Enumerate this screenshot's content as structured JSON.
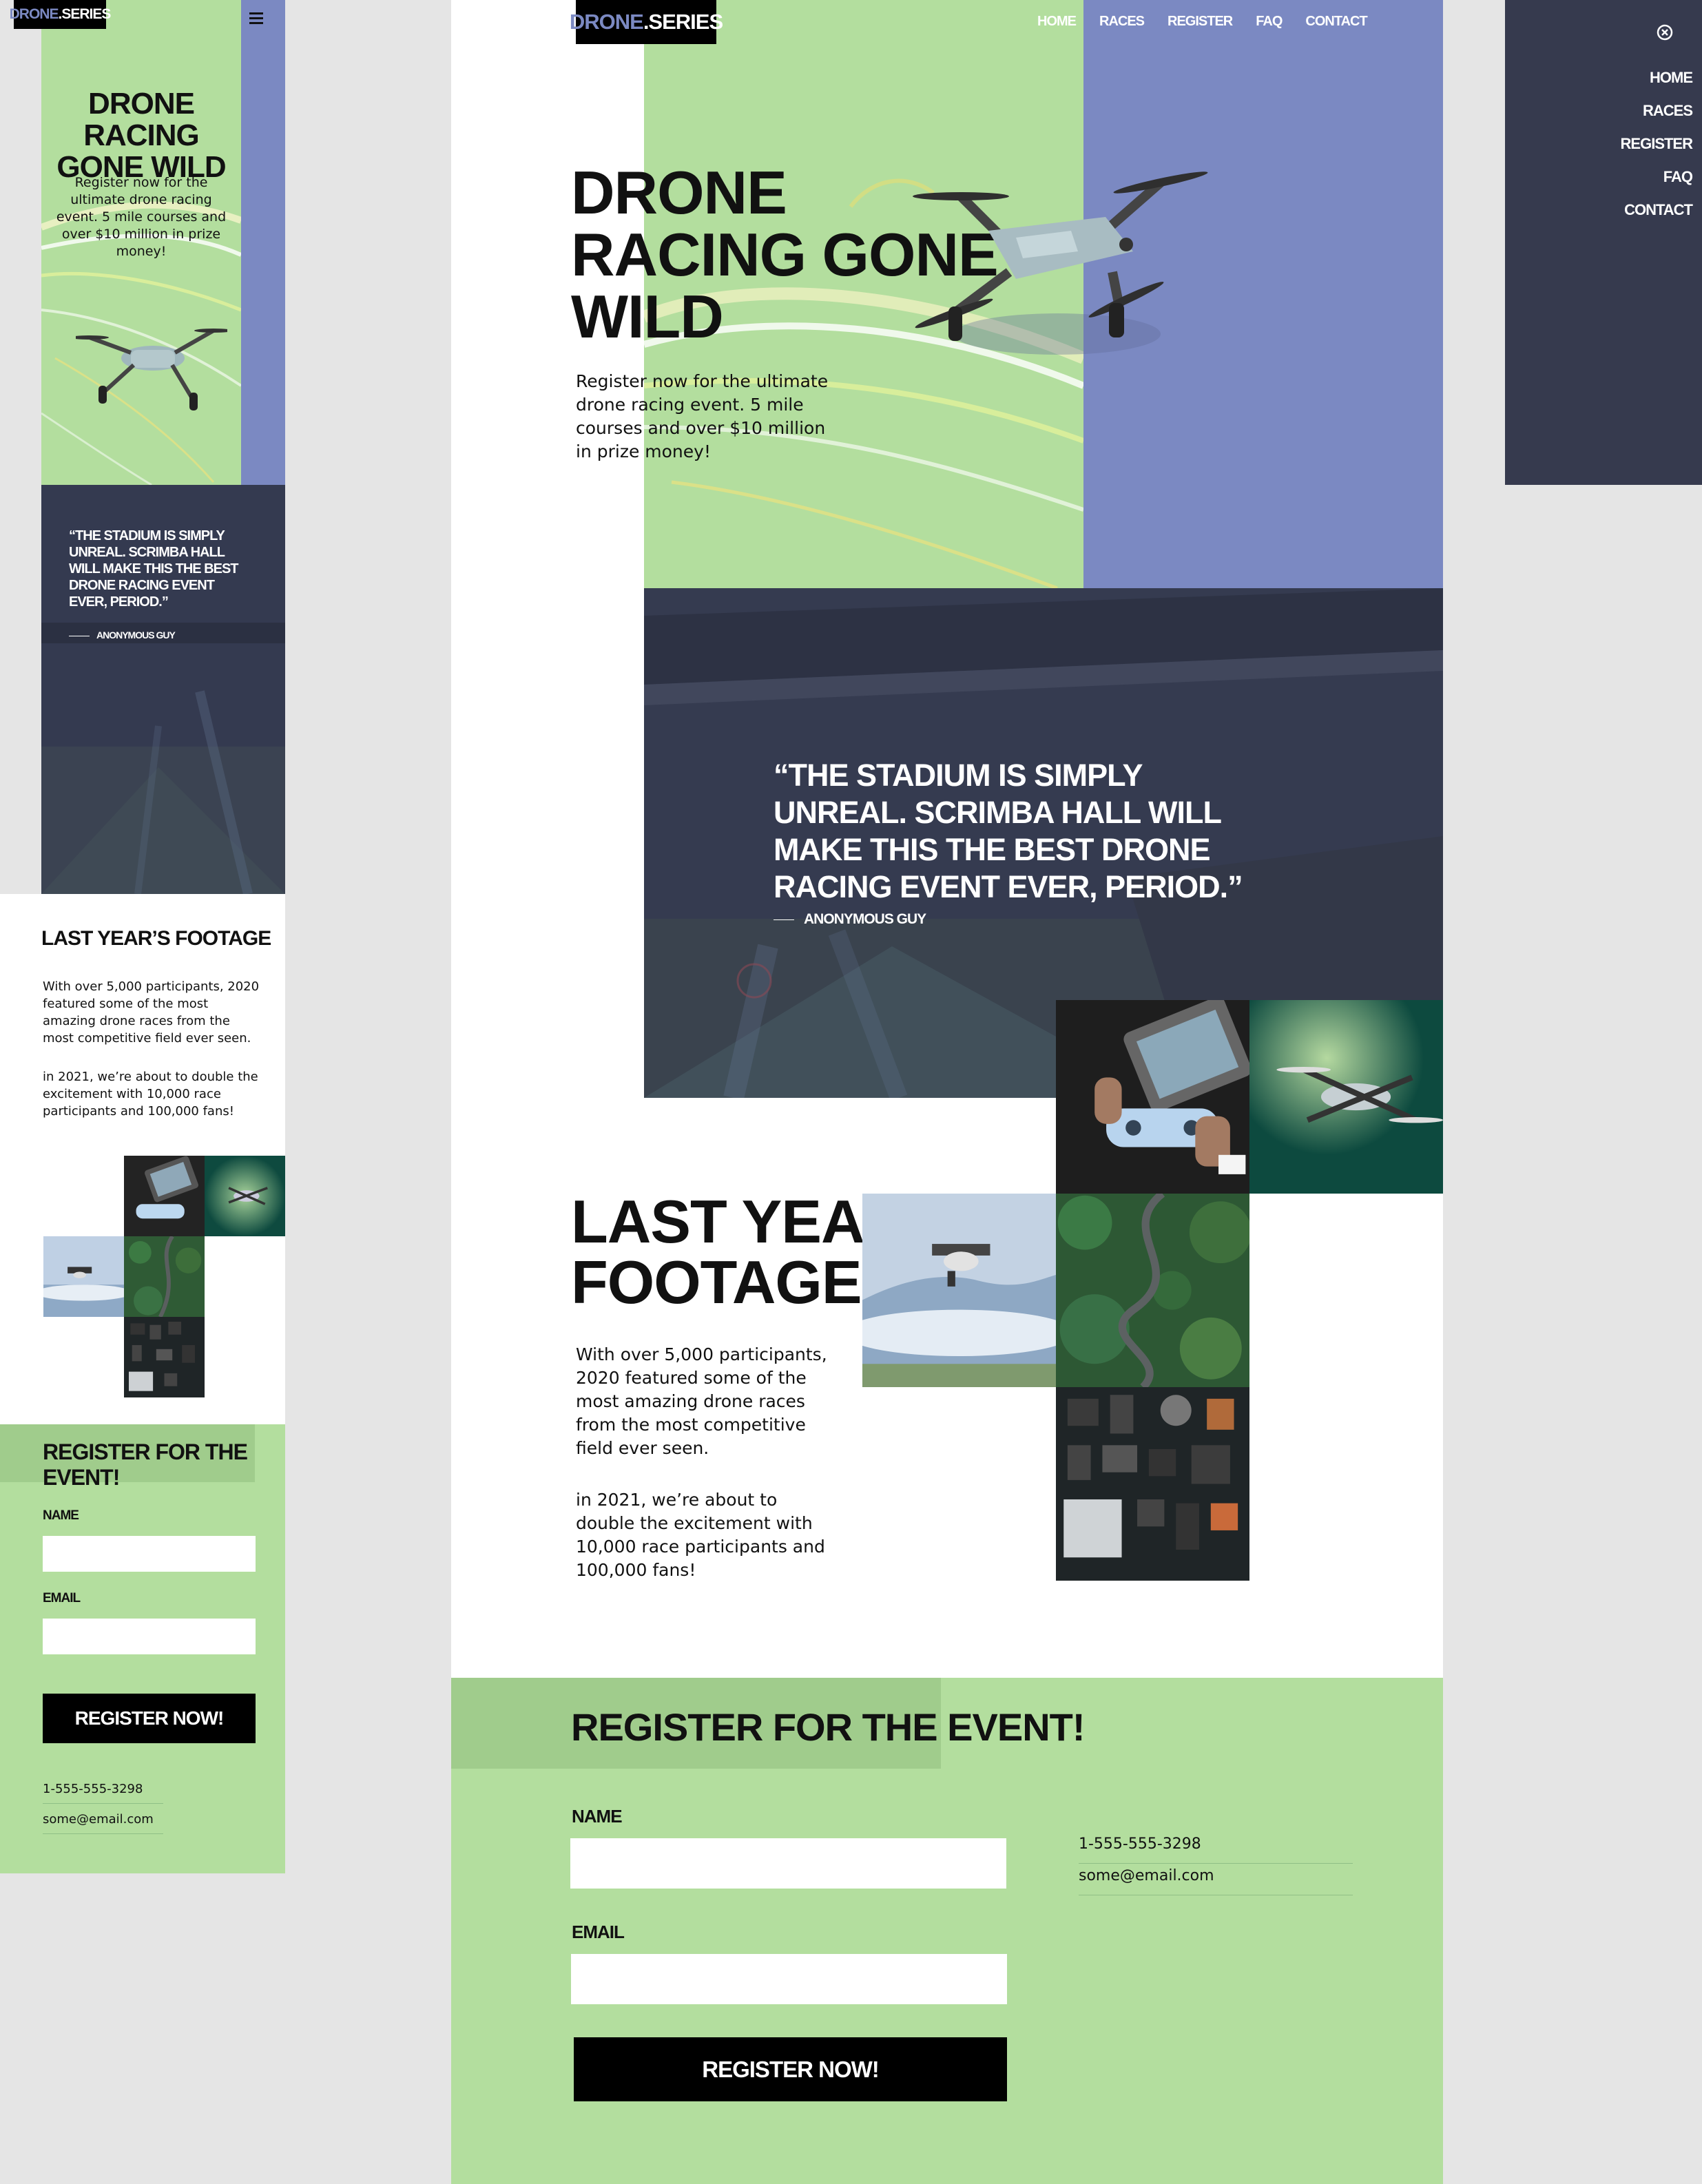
{
  "brand": {
    "logo_accent": "DRONE",
    "logo_rest": ".SERIES"
  },
  "colors": {
    "green": "#b3de9e",
    "green_dark": "#a0cc8c",
    "blue": "#7b89c2",
    "navy": "#363a4e",
    "black": "#000000"
  },
  "nav": {
    "items": [
      "HOME",
      "RACES",
      "REGISTER",
      "FAQ",
      "CONTACT"
    ]
  },
  "hero": {
    "title_desktop": [
      "DRONE",
      "RACING GONE",
      "WILD"
    ],
    "title_mobile": [
      "DRONE RACING",
      "GONE WILD"
    ],
    "text": "Register now for the ultimate drone racing event. 5 mile courses and over $10 million in prize money!"
  },
  "quote": {
    "text": "“THE STADIUM IS SIMPLY UNREAL. SCRIMBA HALL WILL MAKE THIS THE BEST DRONE RACING EVENT EVER, PERIOD.”",
    "author": "ANONYMOUS GUY"
  },
  "footage": {
    "title_desktop": [
      "LAST YEAR’S",
      "FOOTAGE"
    ],
    "title_mobile": "LAST YEAR’S FOOTAGE",
    "p1": "With over 5,000 participants, 2020 featured some of the most amazing drone races from the most competitive field ever seen.",
    "p2": "in 2021, we’re about to double the excitement with 10,000 race participants and 100,000 fans!"
  },
  "register": {
    "title": "REGISTER FOR THE EVENT!",
    "name_label": "NAME",
    "email_label": "EMAIL",
    "name_value": "",
    "email_value": "",
    "button": "REGISTER NOW!",
    "phone": "1-555-555-3298",
    "email": "some@email.com"
  },
  "icons": {
    "menu": "hamburger-menu-icon",
    "close": "close-circle-icon"
  }
}
